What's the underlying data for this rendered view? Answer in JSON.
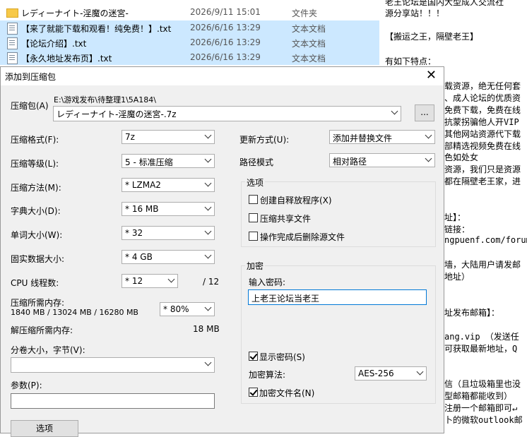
{
  "explorer": {
    "files": [
      {
        "name": "レディーナイト-淫魔の迷宮-",
        "date": "2026/9/11 15:01",
        "type": "文件夹",
        "kind": "folder",
        "selected": false
      },
      {
        "name": "【来了就能下载和观看！纯免费！】.txt",
        "date": "2026/6/16 13:29",
        "type": "文本文档",
        "kind": "txt",
        "selected": true
      },
      {
        "name": "【论坛介绍】.txt",
        "date": "2026/6/16 13:29",
        "type": "文本文档",
        "kind": "txt",
        "selected": true
      },
      {
        "name": "【永久地址发布页】.txt",
        "date": "2026/6/16 13:29",
        "type": "文本文档",
        "kind": "txt",
        "selected": true
      }
    ]
  },
  "notepad": {
    "lines": [
      "老王论坛是国内大型成人交流社",
      "源分享站！！！",
      "【搬运之王，隔壁老王】",
      "有如下特点：",
      "载资源，绝无任何套",
      "、成人论坛的优质资",
      "免费下载，免费在线",
      "抗蒙拐骗他人开VIP",
      "其他网站资源代下载",
      "部精选视频免费在线",
      "色如处女",
      "资源，我们只是资源",
      "都在隔壁老王家，进",
      "址】：",
      "链接：",
      "ngpuenf.com/forum",
      "墙，大陆用户请发邮",
      "地址）",
      "址发布邮箱】：",
      "ang.vip （发送任",
      "可获取最新地址，Q",
      "信（且垃圾箱里也没",
      "型邮箱都能收到）",
      "注册一个邮箱即可↵",
      "卜的微软outlook邮"
    ]
  },
  "dialog": {
    "title": "添加到压缩包",
    "close_symbol": "✕",
    "archive": {
      "label": "压缩包(A)",
      "path": "E:\\游戏发布\\待整理1\\5A184\\",
      "name": "レディーナイト-淫魔の迷宮-.7z",
      "browse_label": "..."
    },
    "format": {
      "label": "压缩格式(F):",
      "value": "7z"
    },
    "level": {
      "label": "压缩等级(L):",
      "value": "5 - 标准压缩"
    },
    "method": {
      "label": "压缩方法(M):",
      "value": "* LZMA2"
    },
    "dict": {
      "label": "字典大小(D):",
      "value": "* 16 MB"
    },
    "word": {
      "label": "单词大小(W):",
      "value": "* 32"
    },
    "solid": {
      "label": "固实数据大小:",
      "value": "* 4 GB"
    },
    "cpu": {
      "label": "CPU 线程数:",
      "value": "* 12",
      "max": "/ 12"
    },
    "memory": {
      "label": "压缩所需内存:",
      "detail": "1840 MB / 13024 MB / 16280 MB",
      "value": "* 80%"
    },
    "decompress": {
      "label": "解压缩所需内存:",
      "value": "18 MB"
    },
    "volume": {
      "label": "分卷大小，字节(V):",
      "value": ""
    },
    "params": {
      "label": "参数(P):",
      "value": ""
    },
    "options_button": "选项",
    "update": {
      "label": "更新方式(U):",
      "value": "添加并替换文件"
    },
    "pathmode": {
      "label": "路径模式",
      "value": "相对路径"
    },
    "options_group": {
      "title": "选项",
      "items": [
        {
          "label": "创建自释放程序(X)",
          "checked": false
        },
        {
          "label": "压缩共享文件",
          "checked": false
        },
        {
          "label": "操作完成后删除源文件",
          "checked": false
        }
      ]
    },
    "encryption": {
      "title": "加密",
      "password_label": "输入密码:",
      "password": "上老王论坛当老王",
      "show_password": {
        "label": "显示密码(S)",
        "checked": true
      },
      "method_label": "加密算法:",
      "method_value": "AES-256",
      "encrypt_names": {
        "label": "加密文件名(N)",
        "checked": true
      }
    }
  }
}
